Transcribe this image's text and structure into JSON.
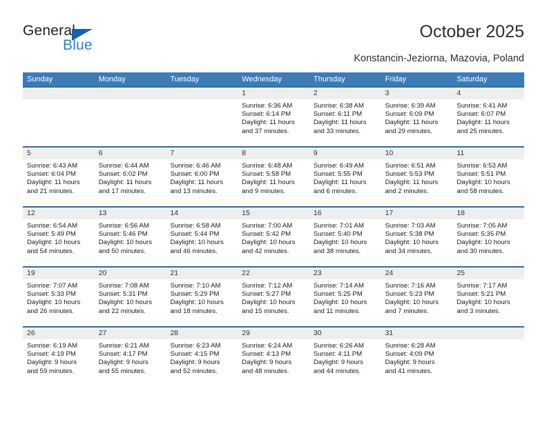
{
  "brand": {
    "name_top": "General",
    "name_bottom": "Blue",
    "accent_color": "#1f82d4",
    "triangle_color": "#1263ad"
  },
  "header": {
    "title": "October 2025",
    "subtitle": "Konstancin-Jeziorna, Mazovia, Poland"
  },
  "calendar": {
    "header_bg": "#3b7cb8",
    "weekdays": [
      "Sunday",
      "Monday",
      "Tuesday",
      "Wednesday",
      "Thursday",
      "Friday",
      "Saturday"
    ],
    "weeks": [
      [
        {
          "day": "",
          "sunrise": "",
          "sunset": "",
          "daylight1": "",
          "daylight2": ""
        },
        {
          "day": "",
          "sunrise": "",
          "sunset": "",
          "daylight1": "",
          "daylight2": ""
        },
        {
          "day": "",
          "sunrise": "",
          "sunset": "",
          "daylight1": "",
          "daylight2": ""
        },
        {
          "day": "1",
          "sunrise": "Sunrise: 6:36 AM",
          "sunset": "Sunset: 6:14 PM",
          "daylight1": "Daylight: 11 hours",
          "daylight2": "and 37 minutes."
        },
        {
          "day": "2",
          "sunrise": "Sunrise: 6:38 AM",
          "sunset": "Sunset: 6:11 PM",
          "daylight1": "Daylight: 11 hours",
          "daylight2": "and 33 minutes."
        },
        {
          "day": "3",
          "sunrise": "Sunrise: 6:39 AM",
          "sunset": "Sunset: 6:09 PM",
          "daylight1": "Daylight: 11 hours",
          "daylight2": "and 29 minutes."
        },
        {
          "day": "4",
          "sunrise": "Sunrise: 6:41 AM",
          "sunset": "Sunset: 6:07 PM",
          "daylight1": "Daylight: 11 hours",
          "daylight2": "and 25 minutes."
        }
      ],
      [
        {
          "day": "5",
          "sunrise": "Sunrise: 6:43 AM",
          "sunset": "Sunset: 6:04 PM",
          "daylight1": "Daylight: 11 hours",
          "daylight2": "and 21 minutes."
        },
        {
          "day": "6",
          "sunrise": "Sunrise: 6:44 AM",
          "sunset": "Sunset: 6:02 PM",
          "daylight1": "Daylight: 11 hours",
          "daylight2": "and 17 minutes."
        },
        {
          "day": "7",
          "sunrise": "Sunrise: 6:46 AM",
          "sunset": "Sunset: 6:00 PM",
          "daylight1": "Daylight: 11 hours",
          "daylight2": "and 13 minutes."
        },
        {
          "day": "8",
          "sunrise": "Sunrise: 6:48 AM",
          "sunset": "Sunset: 5:58 PM",
          "daylight1": "Daylight: 11 hours",
          "daylight2": "and 9 minutes."
        },
        {
          "day": "9",
          "sunrise": "Sunrise: 6:49 AM",
          "sunset": "Sunset: 5:55 PM",
          "daylight1": "Daylight: 11 hours",
          "daylight2": "and 6 minutes."
        },
        {
          "day": "10",
          "sunrise": "Sunrise: 6:51 AM",
          "sunset": "Sunset: 5:53 PM",
          "daylight1": "Daylight: 11 hours",
          "daylight2": "and 2 minutes."
        },
        {
          "day": "11",
          "sunrise": "Sunrise: 6:53 AM",
          "sunset": "Sunset: 5:51 PM",
          "daylight1": "Daylight: 10 hours",
          "daylight2": "and 58 minutes."
        }
      ],
      [
        {
          "day": "12",
          "sunrise": "Sunrise: 6:54 AM",
          "sunset": "Sunset: 5:49 PM",
          "daylight1": "Daylight: 10 hours",
          "daylight2": "and 54 minutes."
        },
        {
          "day": "13",
          "sunrise": "Sunrise: 6:56 AM",
          "sunset": "Sunset: 5:46 PM",
          "daylight1": "Daylight: 10 hours",
          "daylight2": "and 50 minutes."
        },
        {
          "day": "14",
          "sunrise": "Sunrise: 6:58 AM",
          "sunset": "Sunset: 5:44 PM",
          "daylight1": "Daylight: 10 hours",
          "daylight2": "and 46 minutes."
        },
        {
          "day": "15",
          "sunrise": "Sunrise: 7:00 AM",
          "sunset": "Sunset: 5:42 PM",
          "daylight1": "Daylight: 10 hours",
          "daylight2": "and 42 minutes."
        },
        {
          "day": "16",
          "sunrise": "Sunrise: 7:01 AM",
          "sunset": "Sunset: 5:40 PM",
          "daylight1": "Daylight: 10 hours",
          "daylight2": "and 38 minutes."
        },
        {
          "day": "17",
          "sunrise": "Sunrise: 7:03 AM",
          "sunset": "Sunset: 5:38 PM",
          "daylight1": "Daylight: 10 hours",
          "daylight2": "and 34 minutes."
        },
        {
          "day": "18",
          "sunrise": "Sunrise: 7:05 AM",
          "sunset": "Sunset: 5:35 PM",
          "daylight1": "Daylight: 10 hours",
          "daylight2": "and 30 minutes."
        }
      ],
      [
        {
          "day": "19",
          "sunrise": "Sunrise: 7:07 AM",
          "sunset": "Sunset: 5:33 PM",
          "daylight1": "Daylight: 10 hours",
          "daylight2": "and 26 minutes."
        },
        {
          "day": "20",
          "sunrise": "Sunrise: 7:08 AM",
          "sunset": "Sunset: 5:31 PM",
          "daylight1": "Daylight: 10 hours",
          "daylight2": "and 22 minutes."
        },
        {
          "day": "21",
          "sunrise": "Sunrise: 7:10 AM",
          "sunset": "Sunset: 5:29 PM",
          "daylight1": "Daylight: 10 hours",
          "daylight2": "and 18 minutes."
        },
        {
          "day": "22",
          "sunrise": "Sunrise: 7:12 AM",
          "sunset": "Sunset: 5:27 PM",
          "daylight1": "Daylight: 10 hours",
          "daylight2": "and 15 minutes."
        },
        {
          "day": "23",
          "sunrise": "Sunrise: 7:14 AM",
          "sunset": "Sunset: 5:25 PM",
          "daylight1": "Daylight: 10 hours",
          "daylight2": "and 11 minutes."
        },
        {
          "day": "24",
          "sunrise": "Sunrise: 7:16 AM",
          "sunset": "Sunset: 5:23 PM",
          "daylight1": "Daylight: 10 hours",
          "daylight2": "and 7 minutes."
        },
        {
          "day": "25",
          "sunrise": "Sunrise: 7:17 AM",
          "sunset": "Sunset: 5:21 PM",
          "daylight1": "Daylight: 10 hours",
          "daylight2": "and 3 minutes."
        }
      ],
      [
        {
          "day": "26",
          "sunrise": "Sunrise: 6:19 AM",
          "sunset": "Sunset: 4:19 PM",
          "daylight1": "Daylight: 9 hours",
          "daylight2": "and 59 minutes."
        },
        {
          "day": "27",
          "sunrise": "Sunrise: 6:21 AM",
          "sunset": "Sunset: 4:17 PM",
          "daylight1": "Daylight: 9 hours",
          "daylight2": "and 55 minutes."
        },
        {
          "day": "28",
          "sunrise": "Sunrise: 6:23 AM",
          "sunset": "Sunset: 4:15 PM",
          "daylight1": "Daylight: 9 hours",
          "daylight2": "and 52 minutes."
        },
        {
          "day": "29",
          "sunrise": "Sunrise: 6:24 AM",
          "sunset": "Sunset: 4:13 PM",
          "daylight1": "Daylight: 9 hours",
          "daylight2": "and 48 minutes."
        },
        {
          "day": "30",
          "sunrise": "Sunrise: 6:26 AM",
          "sunset": "Sunset: 4:11 PM",
          "daylight1": "Daylight: 9 hours",
          "daylight2": "and 44 minutes."
        },
        {
          "day": "31",
          "sunrise": "Sunrise: 6:28 AM",
          "sunset": "Sunset: 4:09 PM",
          "daylight1": "Daylight: 9 hours",
          "daylight2": "and 41 minutes."
        },
        {
          "day": "",
          "sunrise": "",
          "sunset": "",
          "daylight1": "",
          "daylight2": ""
        }
      ]
    ]
  }
}
